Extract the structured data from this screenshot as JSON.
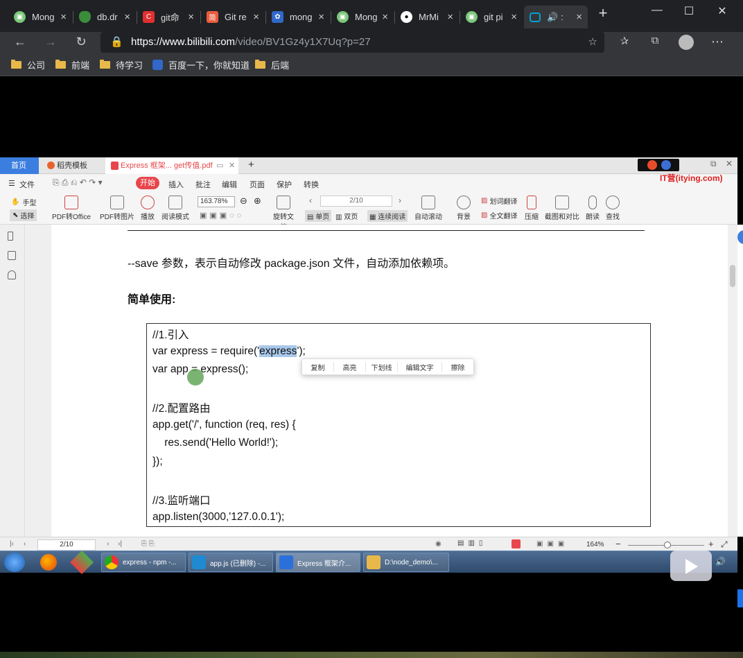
{
  "browser": {
    "tabs": [
      {
        "label": "Mong",
        "icon": "bilibili-icon"
      },
      {
        "label": "db.dr",
        "icon": "mongodb-icon"
      },
      {
        "label": "git命",
        "icon": "csdn-icon"
      },
      {
        "label": "Git re",
        "icon": "jianshu-icon"
      },
      {
        "label": "mong",
        "icon": "baidu-icon"
      },
      {
        "label": "Mong",
        "icon": "bilibili-icon"
      },
      {
        "label": "MrMi",
        "icon": "github-icon"
      },
      {
        "label": "git pi",
        "icon": "bilibili-icon"
      },
      {
        "label": ":",
        "icon": "bilibili-tv-icon",
        "active": true
      }
    ],
    "tab_close": "×",
    "new_tab": "+",
    "url_host": "https://www.bilibili.com",
    "url_path": "/video/BV1Gz4y1X7Uq?p=27",
    "bookmarks": [
      "公司",
      "前端",
      "待学习",
      "百度一下，你就知道",
      "后端"
    ]
  },
  "wps": {
    "tabs": [
      "首页",
      "稻壳模板",
      "Express 框架... get传值.pdf"
    ],
    "menu": [
      "文件",
      "开始",
      "插入",
      "批注",
      "编辑",
      "页面",
      "保护",
      "转换"
    ],
    "tools": {
      "hand": "手型",
      "select": "选择",
      "pdf_office": "PDF转Office",
      "pdf_image": "PDF转图片",
      "play": "播放",
      "read_mode": "阅读模式",
      "zoom": "163.78%",
      "page": "2/10",
      "rotate": "旋转文档",
      "single": "单页",
      "double": "双页",
      "continuous": "连续阅读",
      "autoscroll": "自动滚动",
      "background": "背景",
      "word_translate": "划词翻译",
      "full_translate": "全文翻译",
      "compress": "压缩",
      "screenshot": "截图和对比",
      "read_aloud": "朗读",
      "search": "查找"
    },
    "watermark": "IT营(itying.com)",
    "doc": {
      "line1": "--save 参数，表示自动修改 package.json 文件，自动添加依赖项。",
      "heading": "简单使用:",
      "code": {
        "c1": "//1.引入",
        "c2a": "var express = require('",
        "c2sel": "express",
        "c2b": "');",
        "c3": "var app = express();",
        "c4": "//2.配置路由",
        "c5": "app.get('/', function (req, res) {",
        "c6": "    res.send('Hello World!');",
        "c7": "});",
        "c8": "//3.监听端口",
        "c9": "app.listen(3000,'127.0.0.1');"
      }
    },
    "context_menu": [
      "复制",
      "高亮",
      "下划线",
      "编辑文字",
      "擦除"
    ],
    "status": {
      "page": "2/10",
      "zoom": "164%"
    }
  },
  "taskbar": {
    "items": [
      {
        "label": "express - npm -...",
        "icon": "chrome-icon"
      },
      {
        "label": "app.js (已删除) -...",
        "icon": "vscode-icon"
      },
      {
        "label": "Express 框架介...",
        "icon": "wps-icon"
      },
      {
        "label": "D:\\node_demo\\...",
        "icon": "folder-icon"
      }
    ]
  },
  "colors": {
    "accent_red": "#e8464b",
    "selection": "#a8c8ea",
    "chrome_dark": "#202124"
  }
}
